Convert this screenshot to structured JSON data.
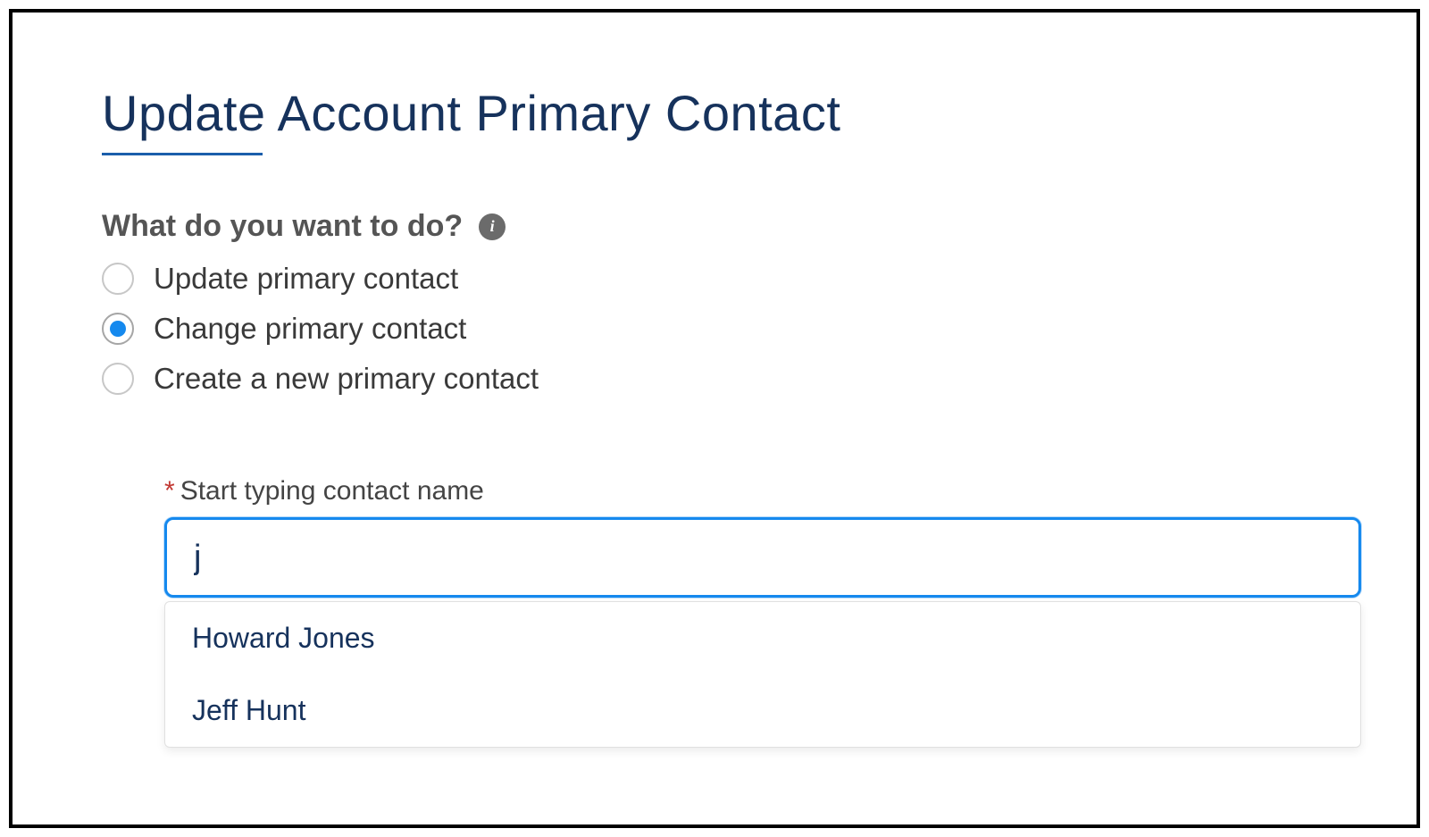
{
  "title": "Update Account Primary Contact",
  "question": {
    "label": "What do you want to do?",
    "infoIcon": "info-icon"
  },
  "options": [
    {
      "label": "Update primary contact",
      "selected": false
    },
    {
      "label": "Change primary contact",
      "selected": true
    },
    {
      "label": "Create a new primary contact",
      "selected": false
    }
  ],
  "lookup": {
    "required": "*",
    "label": "Start typing contact name",
    "value": "j",
    "suggestions": [
      "Howard Jones",
      "Jeff Hunt"
    ]
  }
}
